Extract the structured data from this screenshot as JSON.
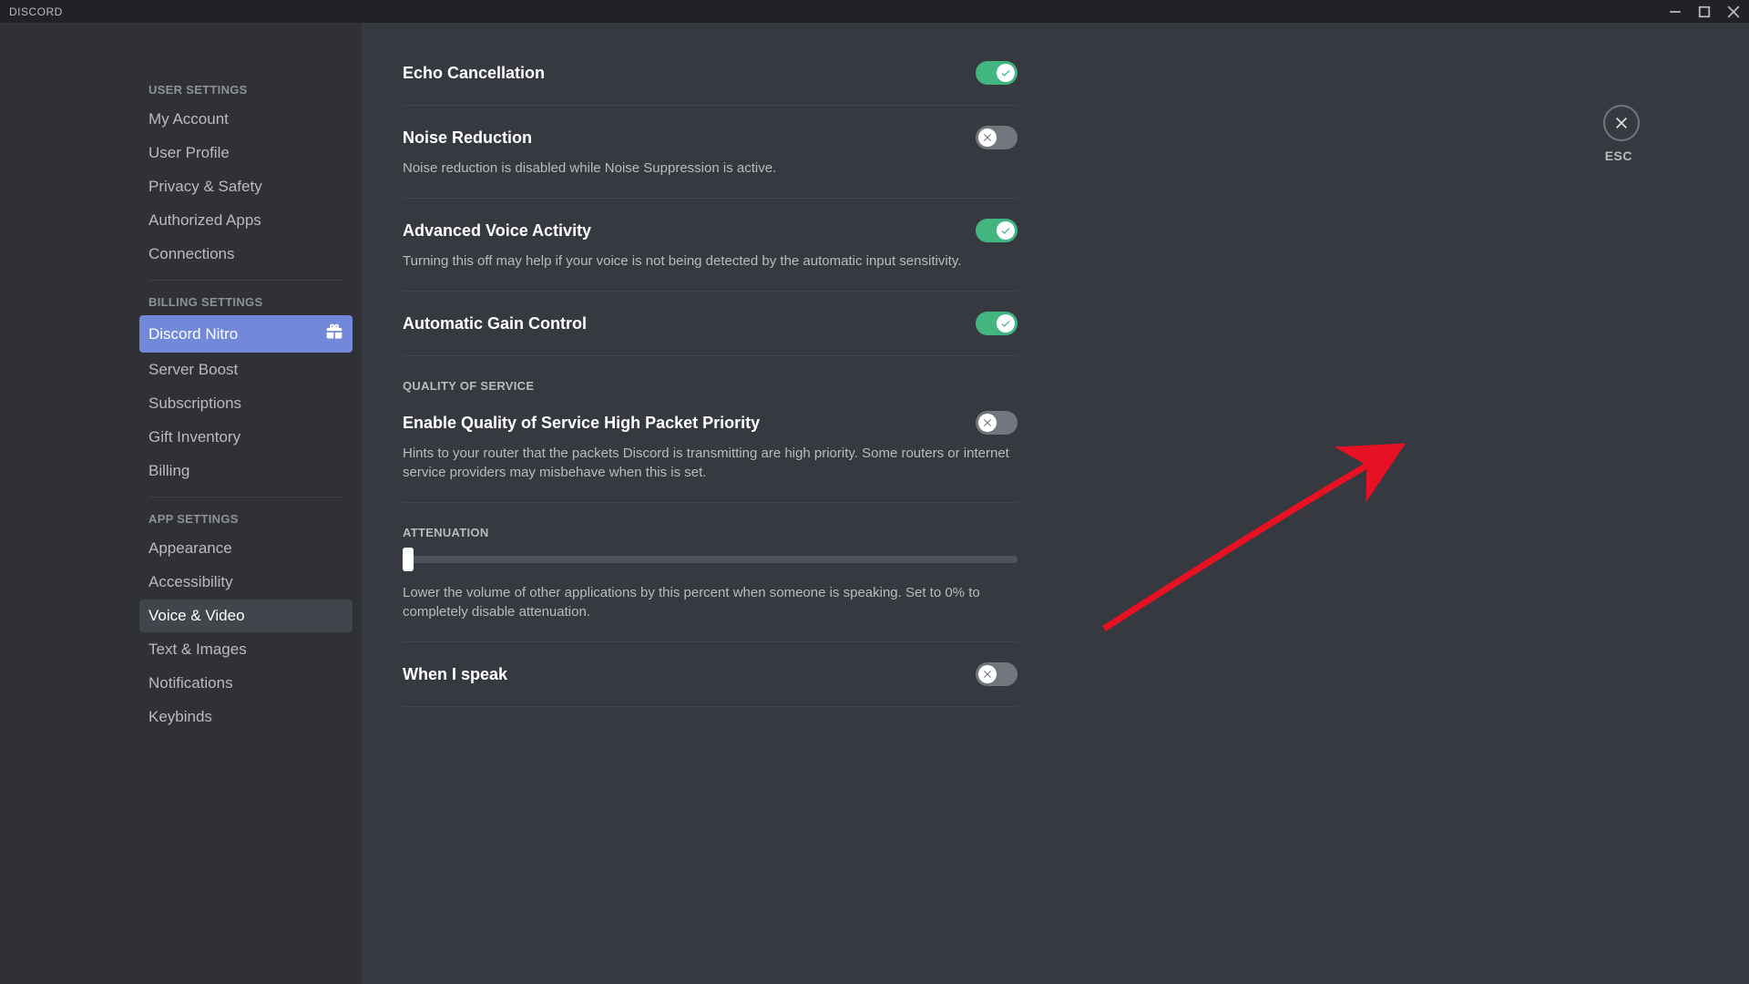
{
  "titlebar": {
    "app": "Discord"
  },
  "closeLabel": "ESC",
  "sidebar": {
    "sections": [
      {
        "header": "User Settings",
        "items": [
          {
            "label": "My Account"
          },
          {
            "label": "User Profile"
          },
          {
            "label": "Privacy & Safety"
          },
          {
            "label": "Authorized Apps"
          },
          {
            "label": "Connections"
          }
        ]
      },
      {
        "header": "Billing Settings",
        "items": [
          {
            "label": "Discord Nitro"
          },
          {
            "label": "Server Boost"
          },
          {
            "label": "Subscriptions"
          },
          {
            "label": "Gift Inventory"
          },
          {
            "label": "Billing"
          }
        ]
      },
      {
        "header": "App Settings",
        "items": [
          {
            "label": "Appearance"
          },
          {
            "label": "Accessibility"
          },
          {
            "label": "Voice & Video"
          },
          {
            "label": "Text & Images"
          },
          {
            "label": "Notifications"
          },
          {
            "label": "Keybinds"
          }
        ]
      }
    ]
  },
  "settings": {
    "echoCancellation": {
      "title": "Echo Cancellation",
      "on": true
    },
    "noiseReduction": {
      "title": "Noise Reduction",
      "desc": "Noise reduction is disabled while Noise Suppression is active.",
      "on": false
    },
    "advancedVoice": {
      "title": "Advanced Voice Activity",
      "desc": "Turning this off may help if your voice is not being detected by the automatic input sensitivity.",
      "on": true
    },
    "autoGain": {
      "title": "Automatic Gain Control",
      "on": true
    },
    "qosHeader": "Quality of Service",
    "qos": {
      "title": "Enable Quality of Service High Packet Priority",
      "desc": "Hints to your router that the packets Discord is transmitting are high priority. Some routers or internet service providers may misbehave when this is set.",
      "on": false
    },
    "attenuationHeader": "Attenuation",
    "attenuation": {
      "desc": "Lower the volume of other applications by this percent when someone is speaking. Set to 0% to completely disable attenuation."
    },
    "whenISpeak": {
      "title": "When I speak",
      "on": false
    }
  }
}
